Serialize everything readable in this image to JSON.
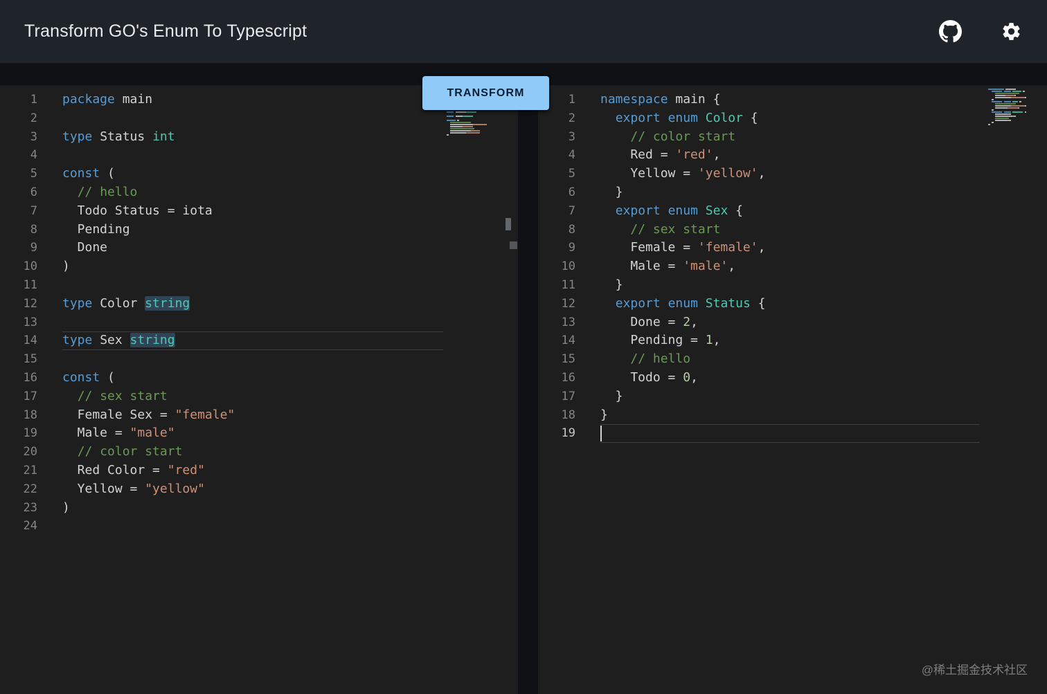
{
  "header": {
    "title": "Transform GO's Enum To Typescript",
    "icons": [
      {
        "name": "github-icon"
      },
      {
        "name": "gear-icon"
      }
    ]
  },
  "transform_button": {
    "label": "TRANSFORM"
  },
  "watermark": "@稀土掘金技术社区",
  "colors": {
    "header_background": "#1f242a",
    "page_background": "#0f1114",
    "editor_background": "#1e1e1e",
    "accent_button": "#90caf9",
    "button_text": "#0b1f33",
    "line_number": "#858585",
    "active_line_number": "#c6c6c6",
    "word_highlight": "rgba(64,105,141,0.5)",
    "tokens": {
      "keyword": "#569cd6",
      "type": "#4ec9b0",
      "comment": "#6a9955",
      "string": "#ce9178",
      "number": "#b5cea8",
      "default": "#d4d4d4"
    }
  },
  "left_editor": {
    "active_line": 14,
    "cursor_line": null,
    "focused": false,
    "lines": [
      [
        {
          "c": "keyword",
          "t": "package"
        },
        {
          "c": "default",
          "t": " main"
        }
      ],
      [],
      [
        {
          "c": "keyword",
          "t": "type"
        },
        {
          "c": "default",
          "t": " Status "
        },
        {
          "c": "type",
          "t": "int"
        }
      ],
      [],
      [
        {
          "c": "keyword",
          "t": "const"
        },
        {
          "c": "default",
          "t": " ("
        }
      ],
      [
        {
          "c": "default",
          "t": "  "
        },
        {
          "c": "comment",
          "t": "// hello"
        }
      ],
      [
        {
          "c": "default",
          "t": "  Todo Status = iota"
        }
      ],
      [
        {
          "c": "default",
          "t": "  Pending"
        }
      ],
      [
        {
          "c": "default",
          "t": "  Done"
        }
      ],
      [
        {
          "c": "default",
          "t": ")"
        }
      ],
      [],
      [
        {
          "c": "keyword",
          "t": "type"
        },
        {
          "c": "default",
          "t": " Color "
        },
        {
          "c": "type",
          "t": "string",
          "hl": true
        }
      ],
      [],
      [
        {
          "c": "keyword",
          "t": "type"
        },
        {
          "c": "default",
          "t": " Sex "
        },
        {
          "c": "type",
          "t": "string",
          "hl": true
        }
      ],
      [],
      [
        {
          "c": "keyword",
          "t": "const"
        },
        {
          "c": "default",
          "t": " ("
        }
      ],
      [
        {
          "c": "default",
          "t": "  "
        },
        {
          "c": "comment",
          "t": "// sex start"
        }
      ],
      [
        {
          "c": "default",
          "t": "  Female Sex = "
        },
        {
          "c": "string",
          "t": "\"female\""
        }
      ],
      [
        {
          "c": "default",
          "t": "  Male = "
        },
        {
          "c": "string",
          "t": "\"male\""
        }
      ],
      [
        {
          "c": "default",
          "t": "  "
        },
        {
          "c": "comment",
          "t": "// color start"
        }
      ],
      [
        {
          "c": "default",
          "t": "  Red Color = "
        },
        {
          "c": "string",
          "t": "\"red\""
        }
      ],
      [
        {
          "c": "default",
          "t": "  Yellow = "
        },
        {
          "c": "string",
          "t": "\"yellow\""
        }
      ],
      [
        {
          "c": "default",
          "t": ")"
        }
      ],
      []
    ]
  },
  "right_editor": {
    "active_line": 19,
    "cursor_line": 19,
    "focused": true,
    "lines": [
      [
        {
          "c": "keyword",
          "t": "namespace"
        },
        {
          "c": "default",
          "t": " main {"
        }
      ],
      [
        {
          "c": "default",
          "t": "  "
        },
        {
          "c": "keyword",
          "t": "export"
        },
        {
          "c": "default",
          "t": " "
        },
        {
          "c": "keyword",
          "t": "enum"
        },
        {
          "c": "default",
          "t": " "
        },
        {
          "c": "type",
          "t": "Color"
        },
        {
          "c": "default",
          "t": " {"
        }
      ],
      [
        {
          "c": "default",
          "t": "    "
        },
        {
          "c": "comment",
          "t": "// color start"
        }
      ],
      [
        {
          "c": "default",
          "t": "    Red = "
        },
        {
          "c": "string",
          "t": "'red'"
        },
        {
          "c": "default",
          "t": ","
        }
      ],
      [
        {
          "c": "default",
          "t": "    Yellow = "
        },
        {
          "c": "string",
          "t": "'yellow'"
        },
        {
          "c": "default",
          "t": ","
        }
      ],
      [
        {
          "c": "default",
          "t": "  }"
        }
      ],
      [
        {
          "c": "default",
          "t": "  "
        },
        {
          "c": "keyword",
          "t": "export"
        },
        {
          "c": "default",
          "t": " "
        },
        {
          "c": "keyword",
          "t": "enum"
        },
        {
          "c": "default",
          "t": " "
        },
        {
          "c": "type",
          "t": "Sex"
        },
        {
          "c": "default",
          "t": " {"
        }
      ],
      [
        {
          "c": "default",
          "t": "    "
        },
        {
          "c": "comment",
          "t": "// sex start"
        }
      ],
      [
        {
          "c": "default",
          "t": "    Female = "
        },
        {
          "c": "string",
          "t": "'female'"
        },
        {
          "c": "default",
          "t": ","
        }
      ],
      [
        {
          "c": "default",
          "t": "    Male = "
        },
        {
          "c": "string",
          "t": "'male'"
        },
        {
          "c": "default",
          "t": ","
        }
      ],
      [
        {
          "c": "default",
          "t": "  }"
        }
      ],
      [
        {
          "c": "default",
          "t": "  "
        },
        {
          "c": "keyword",
          "t": "export"
        },
        {
          "c": "default",
          "t": " "
        },
        {
          "c": "keyword",
          "t": "enum"
        },
        {
          "c": "default",
          "t": " "
        },
        {
          "c": "type",
          "t": "Status"
        },
        {
          "c": "default",
          "t": " {"
        }
      ],
      [
        {
          "c": "default",
          "t": "    Done = "
        },
        {
          "c": "number",
          "t": "2"
        },
        {
          "c": "default",
          "t": ","
        }
      ],
      [
        {
          "c": "default",
          "t": "    Pending = "
        },
        {
          "c": "number",
          "t": "1"
        },
        {
          "c": "default",
          "t": ","
        }
      ],
      [
        {
          "c": "default",
          "t": "    "
        },
        {
          "c": "comment",
          "t": "// hello"
        }
      ],
      [
        {
          "c": "default",
          "t": "    Todo = "
        },
        {
          "c": "number",
          "t": "0"
        },
        {
          "c": "default",
          "t": ","
        }
      ],
      [
        {
          "c": "default",
          "t": "  }"
        }
      ],
      [
        {
          "c": "default",
          "t": "}"
        }
      ],
      []
    ]
  }
}
